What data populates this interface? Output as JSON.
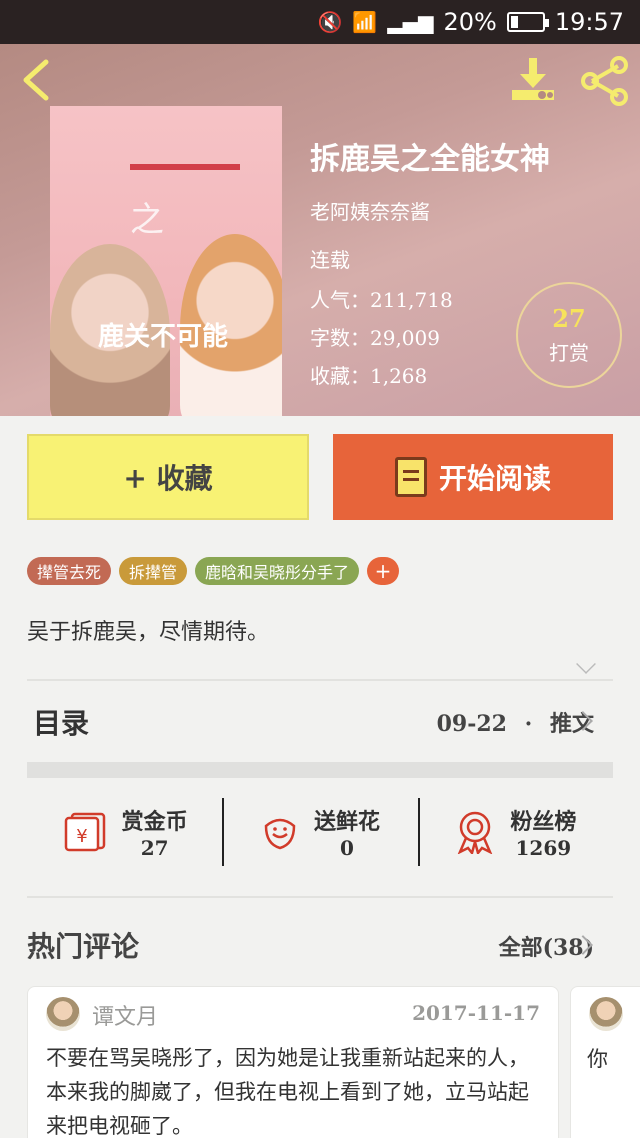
{
  "status_bar": {
    "battery": "20%",
    "time": "19:57",
    "battery_level": 0.2
  },
  "book": {
    "title": "拆鹿吴之全能女神",
    "author": "老阿姨奈奈酱",
    "status": "连载",
    "popularity_label": "人气：",
    "popularity": "211,718",
    "words_label": "字数：",
    "words": "29,009",
    "favorites_label": "收藏：",
    "favorites": "1,268",
    "cover_text": "鹿关不可能",
    "cover_zhi": "之"
  },
  "tip": {
    "count": "27",
    "label": "打赏"
  },
  "actions": {
    "favorite": "+ 收藏",
    "read": "开始阅读"
  },
  "tags": [
    {
      "label": "撵管去死",
      "color": "#c26a54"
    },
    {
      "label": "拆撵管",
      "color": "#c99a3a"
    },
    {
      "label": "鹿晗和吴晓彤分手了",
      "color": "#8aa653"
    }
  ],
  "tag_add": "+",
  "description": "吴于拆鹿吴，尽情期待。",
  "toc": {
    "title": "目录",
    "date": "09-22",
    "sep": "·",
    "latest": "推文"
  },
  "stats": [
    {
      "title": "赏金币",
      "value": "27"
    },
    {
      "title": "送鲜花",
      "value": "0"
    },
    {
      "title": "粉丝榜",
      "value": "1269"
    }
  ],
  "hot_comments": {
    "title": "热门评论",
    "all": "全部(38)"
  },
  "comments": [
    {
      "user": "谭文月",
      "date": "2017-11-17",
      "text": "不要在骂吴晓彤了，因为她是让我重新站起来的人，本来我的脚崴了，但我在电视上看到了她，立马站起来把电视砸了。"
    },
    {
      "text": "你"
    }
  ],
  "colors": {
    "accent_orange": "#e7643a",
    "fav_yellow": "#f8f274",
    "tip_yellow": "#f7e35b",
    "red_icon": "#d13b2a"
  }
}
